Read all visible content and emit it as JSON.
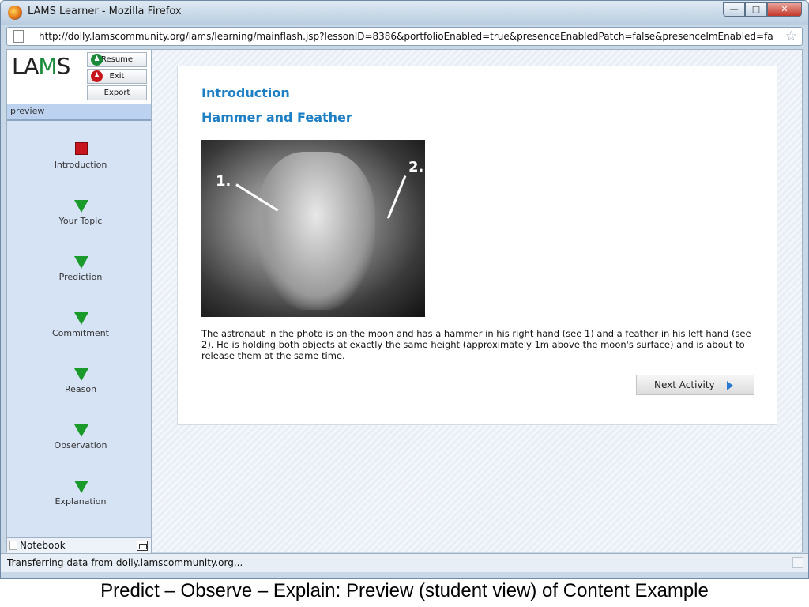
{
  "window": {
    "title": "LAMS Learner - Mozilla Firefox",
    "controls": {
      "minimize": "—",
      "maximize": "□",
      "close": "✕"
    }
  },
  "browser": {
    "url": "http://dolly.lamscommunity.org/lams/learning/mainflash.jsp?lessonID=8386&portfolioEnabled=true&presenceEnabledPatch=false&presenceImEnabled=fa"
  },
  "sidebar": {
    "logo": {
      "left": "LA",
      "mark": "M",
      "right": "S"
    },
    "buttons": {
      "resume": "Resume",
      "exit": "Exit",
      "export": "Export"
    },
    "preview_label": "preview",
    "activities": [
      {
        "label": "Introduction",
        "marker": "current"
      },
      {
        "label": "Your Topic",
        "marker": "todo"
      },
      {
        "label": "Prediction",
        "marker": "todo"
      },
      {
        "label": "Commitment",
        "marker": "todo"
      },
      {
        "label": "Reason",
        "marker": "todo"
      },
      {
        "label": "Observation",
        "marker": "todo"
      },
      {
        "label": "Explanation",
        "marker": "todo"
      }
    ],
    "notebook_label": "Notebook"
  },
  "main": {
    "heading": "Introduction",
    "subheading": "Hammer and Feather",
    "photo_labels": {
      "one": "1.",
      "two": "2."
    },
    "description": "The astronaut in the photo is on the moon and has a hammer in his right hand (see 1) and a feather in his left hand (see 2). He is holding both objects at exactly the same height (approximately 1m above the moon's surface) and is about to release them at the same time.",
    "next_button": "Next Activity"
  },
  "statusbar": {
    "text": "Transferring data from dolly.lamscommunity.org..."
  },
  "caption": "Predict – Observe – Explain: Preview (student view) of Content Example",
  "colors": {
    "heading": "#1f7fc4",
    "current_marker": "#c8141c",
    "todo_marker": "#1a9a2a"
  }
}
